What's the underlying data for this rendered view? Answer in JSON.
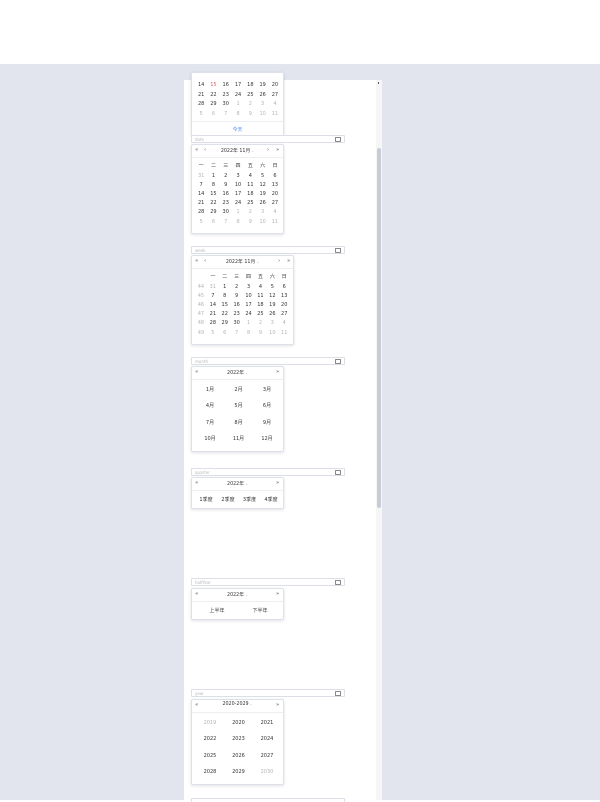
{
  "inputs": {
    "date": {
      "placeholder": "date"
    },
    "week": {
      "placeholder": "week"
    },
    "month": {
      "placeholder": "month"
    },
    "quarter": {
      "placeholder": "quarter"
    },
    "half_year": {
      "placeholder": "halfYear"
    },
    "year": {
      "placeholder": "year"
    }
  },
  "top_popup": {
    "rows": [
      [
        {
          "t": "14"
        },
        {
          "t": "15",
          "today": true
        },
        {
          "t": "16"
        },
        {
          "t": "17"
        },
        {
          "t": "18"
        },
        {
          "t": "19"
        },
        {
          "t": "20"
        }
      ],
      [
        {
          "t": "21"
        },
        {
          "t": "22"
        },
        {
          "t": "23"
        },
        {
          "t": "24"
        },
        {
          "t": "25"
        },
        {
          "t": "26"
        },
        {
          "t": "27"
        }
      ],
      [
        {
          "t": "28"
        },
        {
          "t": "29"
        },
        {
          "t": "30"
        },
        {
          "t": "1",
          "o": true
        },
        {
          "t": "2",
          "o": true
        },
        {
          "t": "3",
          "o": true
        },
        {
          "t": "4",
          "o": true
        }
      ],
      [
        {
          "t": "5",
          "o": true
        },
        {
          "t": "6",
          "o": true
        },
        {
          "t": "7",
          "o": true
        },
        {
          "t": "8",
          "o": true
        },
        {
          "t": "9",
          "o": true
        },
        {
          "t": "10",
          "o": true
        },
        {
          "t": "11",
          "o": true
        }
      ]
    ],
    "today_label": "今天"
  },
  "date_popup": {
    "title": "2022年 11月",
    "weekdays": [
      "一",
      "二",
      "三",
      "四",
      "五",
      "六",
      "日"
    ],
    "rows": [
      [
        {
          "t": "31",
          "o": true
        },
        {
          "t": "1"
        },
        {
          "t": "2"
        },
        {
          "t": "3"
        },
        {
          "t": "4"
        },
        {
          "t": "5"
        },
        {
          "t": "6"
        }
      ],
      [
        {
          "t": "7"
        },
        {
          "t": "8"
        },
        {
          "t": "9"
        },
        {
          "t": "10"
        },
        {
          "t": "11"
        },
        {
          "t": "12"
        },
        {
          "t": "13"
        }
      ],
      [
        {
          "t": "14"
        },
        {
          "t": "15"
        },
        {
          "t": "16"
        },
        {
          "t": "17"
        },
        {
          "t": "18"
        },
        {
          "t": "19"
        },
        {
          "t": "20"
        }
      ],
      [
        {
          "t": "21"
        },
        {
          "t": "22"
        },
        {
          "t": "23"
        },
        {
          "t": "24"
        },
        {
          "t": "25"
        },
        {
          "t": "26"
        },
        {
          "t": "27"
        }
      ],
      [
        {
          "t": "28"
        },
        {
          "t": "29"
        },
        {
          "t": "30"
        },
        {
          "t": "1",
          "o": true
        },
        {
          "t": "2",
          "o": true
        },
        {
          "t": "3",
          "o": true
        },
        {
          "t": "4",
          "o": true
        }
      ],
      [
        {
          "t": "5",
          "o": true
        },
        {
          "t": "6",
          "o": true
        },
        {
          "t": "7",
          "o": true
        },
        {
          "t": "8",
          "o": true
        },
        {
          "t": "9",
          "o": true
        },
        {
          "t": "10",
          "o": true
        },
        {
          "t": "11",
          "o": true
        }
      ]
    ]
  },
  "week_popup": {
    "title": "2022年 11月",
    "weekdays": [
      "一",
      "二",
      "三",
      "四",
      "五",
      "六",
      "日"
    ],
    "week_numbers": [
      "44",
      "45",
      "46",
      "47",
      "48",
      "49"
    ],
    "rows": [
      [
        {
          "t": "31",
          "o": true
        },
        {
          "t": "1"
        },
        {
          "t": "2"
        },
        {
          "t": "3"
        },
        {
          "t": "4"
        },
        {
          "t": "5"
        },
        {
          "t": "6"
        }
      ],
      [
        {
          "t": "7"
        },
        {
          "t": "8"
        },
        {
          "t": "9"
        },
        {
          "t": "10"
        },
        {
          "t": "11"
        },
        {
          "t": "12"
        },
        {
          "t": "13"
        }
      ],
      [
        {
          "t": "14"
        },
        {
          "t": "15"
        },
        {
          "t": "16"
        },
        {
          "t": "17"
        },
        {
          "t": "18"
        },
        {
          "t": "19"
        },
        {
          "t": "20"
        }
      ],
      [
        {
          "t": "21"
        },
        {
          "t": "22"
        },
        {
          "t": "23"
        },
        {
          "t": "24"
        },
        {
          "t": "25"
        },
        {
          "t": "26"
        },
        {
          "t": "27"
        }
      ],
      [
        {
          "t": "28"
        },
        {
          "t": "29"
        },
        {
          "t": "30"
        },
        {
          "t": "1",
          "o": true
        },
        {
          "t": "2",
          "o": true
        },
        {
          "t": "3",
          "o": true
        },
        {
          "t": "4",
          "o": true
        }
      ],
      [
        {
          "t": "5",
          "o": true
        },
        {
          "t": "6",
          "o": true
        },
        {
          "t": "7",
          "o": true
        },
        {
          "t": "8",
          "o": true
        },
        {
          "t": "9",
          "o": true
        },
        {
          "t": "10",
          "o": true
        },
        {
          "t": "11",
          "o": true
        }
      ]
    ]
  },
  "month_popup": {
    "title": "2022年",
    "months": [
      "1月",
      "2月",
      "3月",
      "4月",
      "5月",
      "6月",
      "7月",
      "8月",
      "9月",
      "10月",
      "11月",
      "12月"
    ]
  },
  "quarter_popup": {
    "title": "2022年",
    "quarters": [
      "1季度",
      "2季度",
      "3季度",
      "4季度"
    ]
  },
  "halfyear_popup": {
    "title": "2022年",
    "halves": [
      "上半年",
      "下半年"
    ]
  },
  "year_popup": {
    "title": "2020-2029",
    "years": [
      {
        "t": "2019",
        "o": true
      },
      {
        "t": "2020"
      },
      {
        "t": "2021"
      },
      {
        "t": "2022"
      },
      {
        "t": "2023"
      },
      {
        "t": "2024"
      },
      {
        "t": "2025"
      },
      {
        "t": "2026"
      },
      {
        "t": "2027"
      },
      {
        "t": "2028"
      },
      {
        "t": "2029"
      },
      {
        "t": "2030",
        "o": true
      }
    ]
  },
  "nav": {
    "prev_year": "«",
    "prev_month": "‹",
    "next_month": "›",
    "next_year": "»",
    "dropdown": "⌄"
  },
  "colors": {
    "accent": "#4b8bf4",
    "today": "#e05a6a",
    "muted": "#b5b5b5",
    "border": "#dcdfe6",
    "page_bg": "#e2e5ee"
  }
}
